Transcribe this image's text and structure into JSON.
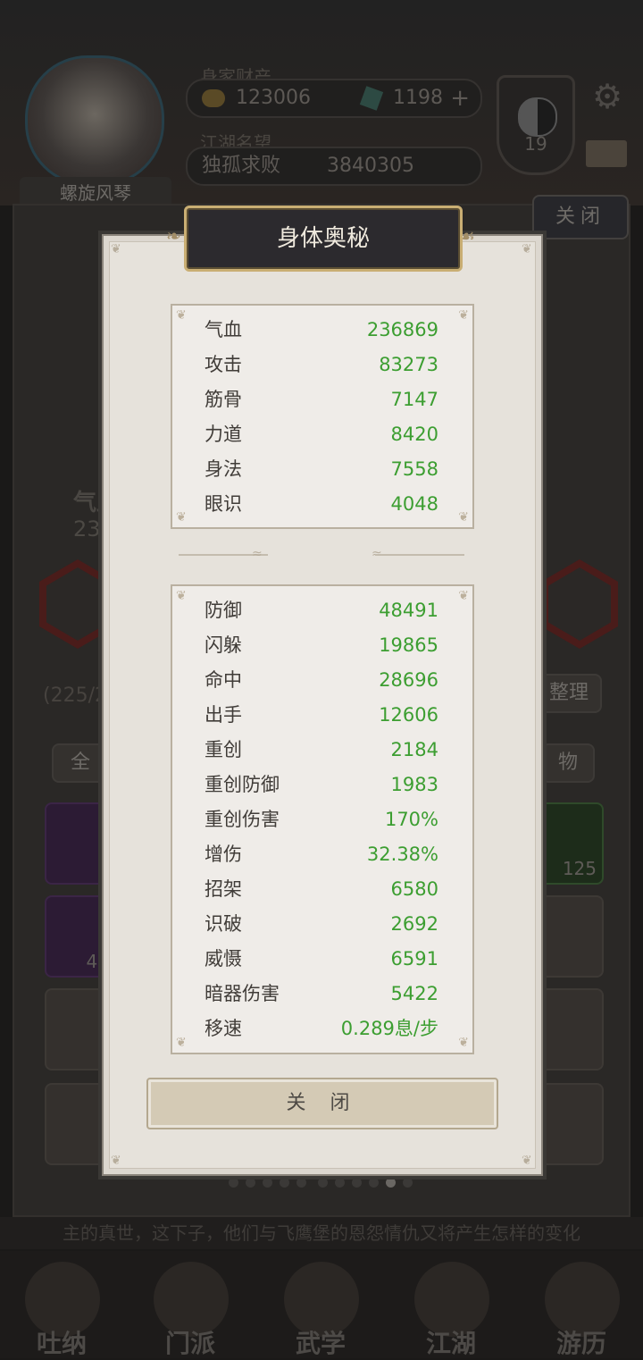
{
  "background": {
    "player_name": "螺旋风琴",
    "family_wealth_label": "身家财产",
    "coins": "123006",
    "gems": "1198",
    "plus_label": "+",
    "reputation_label": "江湖名望",
    "reputation_title": "独孤求败",
    "reputation_value": "3840305",
    "level": "19",
    "top_close_label": "关闭",
    "hp_label_partial": "气血",
    "hp_value_partial": "23",
    "bag_count_partial": "(225/2",
    "sort_label": "整理",
    "filter_all_label": "全",
    "filter_items_label": "物",
    "slot_count_right": "125",
    "slot_count_left": "43",
    "ticker_text": "主的真世，这下子，他们与飞鹰堡的恩怨情仇又将产生怎样的变化",
    "nav": [
      "吐纳",
      "门派",
      "武学",
      "江湖",
      "游历"
    ]
  },
  "modal": {
    "title": "身体奥秘",
    "primary_stats": [
      {
        "name": "气血",
        "value": "236869"
      },
      {
        "name": "攻击",
        "value": "83273"
      },
      {
        "name": "筋骨",
        "value": "7147"
      },
      {
        "name": "力道",
        "value": "8420"
      },
      {
        "name": "身法",
        "value": "7558"
      },
      {
        "name": "眼识",
        "value": "4048"
      }
    ],
    "secondary_stats": [
      {
        "name": "防御",
        "value": "48491"
      },
      {
        "name": "闪躲",
        "value": "19865"
      },
      {
        "name": "命中",
        "value": "28696"
      },
      {
        "name": "出手",
        "value": "12606"
      },
      {
        "name": "重创",
        "value": "2184"
      },
      {
        "name": "重创防御",
        "value": "1983"
      },
      {
        "name": "重创伤害",
        "value": "170%"
      },
      {
        "name": "增伤",
        "value": "32.38%"
      },
      {
        "name": "招架",
        "value": "6580"
      },
      {
        "name": "识破",
        "value": "2692"
      },
      {
        "name": "威慑",
        "value": "6591"
      },
      {
        "name": "暗器伤害",
        "value": "5422"
      },
      {
        "name": "移速",
        "value": "0.289息/步"
      }
    ],
    "close_label": "关 闭"
  },
  "colors": {
    "stat_value": "#3c9e31",
    "stat_name": "#403c38",
    "title_border": "#c9ae73"
  }
}
